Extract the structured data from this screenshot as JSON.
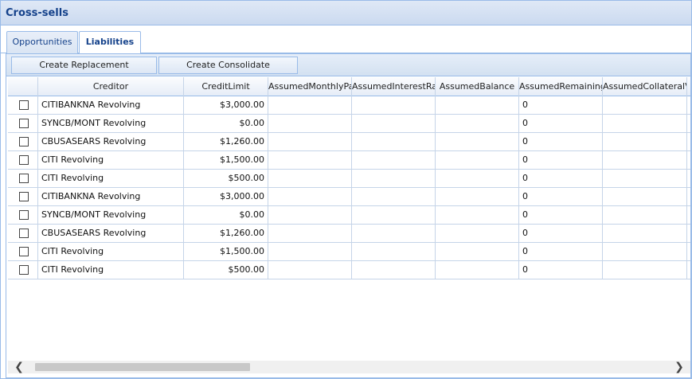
{
  "window": {
    "title": "Cross-sells"
  },
  "tabs": [
    {
      "label": "Opportunities"
    },
    {
      "label": "Liabilities"
    }
  ],
  "toolbar": {
    "replacement_label": "Create Replacement Opportunity",
    "consolidate_label": "Create Consolidate Opportunity"
  },
  "grid": {
    "columns": [
      "Creditor",
      "CreditLimit",
      "AssumedMonthlyPay",
      "AssumedInterestRat",
      "AssumedBalance",
      "AssumedRemainingT",
      "AssumedCollateralVal"
    ],
    "rows": [
      {
        "creditor": "CITIBANKNA Revolving",
        "credit_limit": "$3,000.00",
        "remaining": "0"
      },
      {
        "creditor": "SYNCB/MONT Revolving",
        "credit_limit": "$0.00",
        "remaining": "0"
      },
      {
        "creditor": "CBUSASEARS Revolving",
        "credit_limit": "$1,260.00",
        "remaining": "0"
      },
      {
        "creditor": "CITI Revolving",
        "credit_limit": "$1,500.00",
        "remaining": "0"
      },
      {
        "creditor": "CITI Revolving",
        "credit_limit": "$500.00",
        "remaining": "0"
      },
      {
        "creditor": "CITIBANKNA Revolving",
        "credit_limit": "$3,000.00",
        "remaining": "0"
      },
      {
        "creditor": "SYNCB/MONT Revolving",
        "credit_limit": "$0.00",
        "remaining": "0"
      },
      {
        "creditor": "CBUSASEARS Revolving",
        "credit_limit": "$1,260.00",
        "remaining": "0"
      },
      {
        "creditor": "CITI Revolving",
        "credit_limit": "$1,500.00",
        "remaining": "0"
      },
      {
        "creditor": "CITI Revolving",
        "credit_limit": "$500.00",
        "remaining": "0"
      }
    ]
  },
  "scrollbar": {
    "left_arrow": "❮",
    "right_arrow": "❯"
  },
  "colors": {
    "title": "#15428b",
    "border": "#99bbe8",
    "grid_line": "#c5d4e8"
  }
}
